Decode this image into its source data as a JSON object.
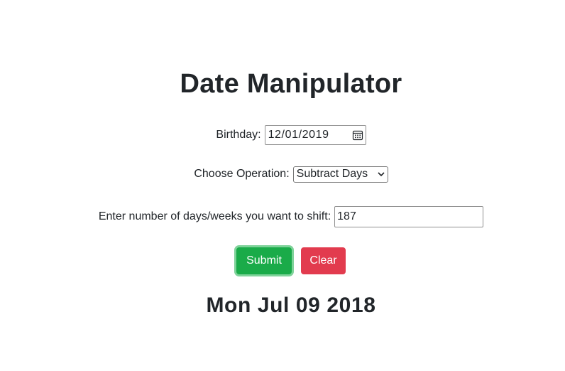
{
  "page": {
    "title": "Date Manipulator"
  },
  "birthday": {
    "label": "Birthday:",
    "value": "12/01/2019",
    "icon": "calendar-icon"
  },
  "operation": {
    "label": "Choose Operation:",
    "selected": "Subtract Days",
    "icon": "chevron-down-icon"
  },
  "shift": {
    "label": "Enter number of days/weeks you want to shift:",
    "value": "187"
  },
  "buttons": {
    "submit_label": "Submit",
    "clear_label": "Clear",
    "submit_color": "#1aab49",
    "clear_color": "#e23b4e"
  },
  "result": {
    "text": "Mon Jul 09 2018"
  }
}
